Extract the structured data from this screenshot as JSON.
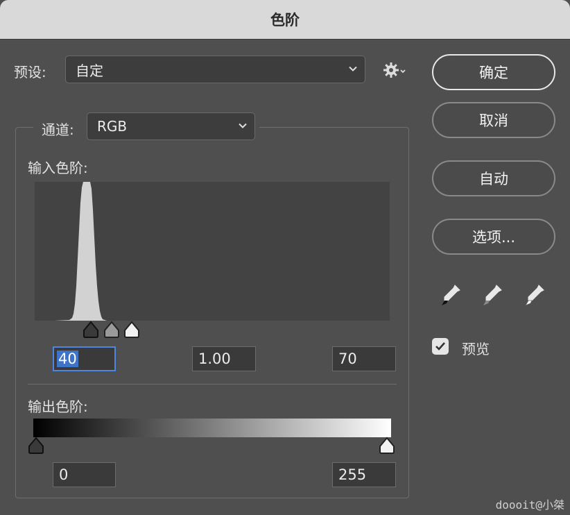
{
  "dialog": {
    "title": "色阶"
  },
  "preset": {
    "label": "预设:",
    "value": "自定"
  },
  "channel": {
    "label": "通道:",
    "value": "RGB"
  },
  "input_levels": {
    "label": "输入色阶:",
    "black": "40",
    "gamma": "1.00",
    "white": "70"
  },
  "output_levels": {
    "label": "输出色阶:",
    "black": "0",
    "white": "255"
  },
  "buttons": {
    "ok": "确定",
    "cancel": "取消",
    "auto": "自动",
    "options": "选项..."
  },
  "preview": {
    "label": "预览",
    "checked": true
  },
  "eyedroppers": [
    "black-point-eyedropper-icon",
    "gray-point-eyedropper-icon",
    "white-point-eyedropper-icon"
  ],
  "watermark": "doooit@小桀",
  "colors": {
    "dialog_bg": "#4f4f4f",
    "titlebar_bg": "#d9d9d9",
    "focus_accent": "#4d86e0"
  }
}
